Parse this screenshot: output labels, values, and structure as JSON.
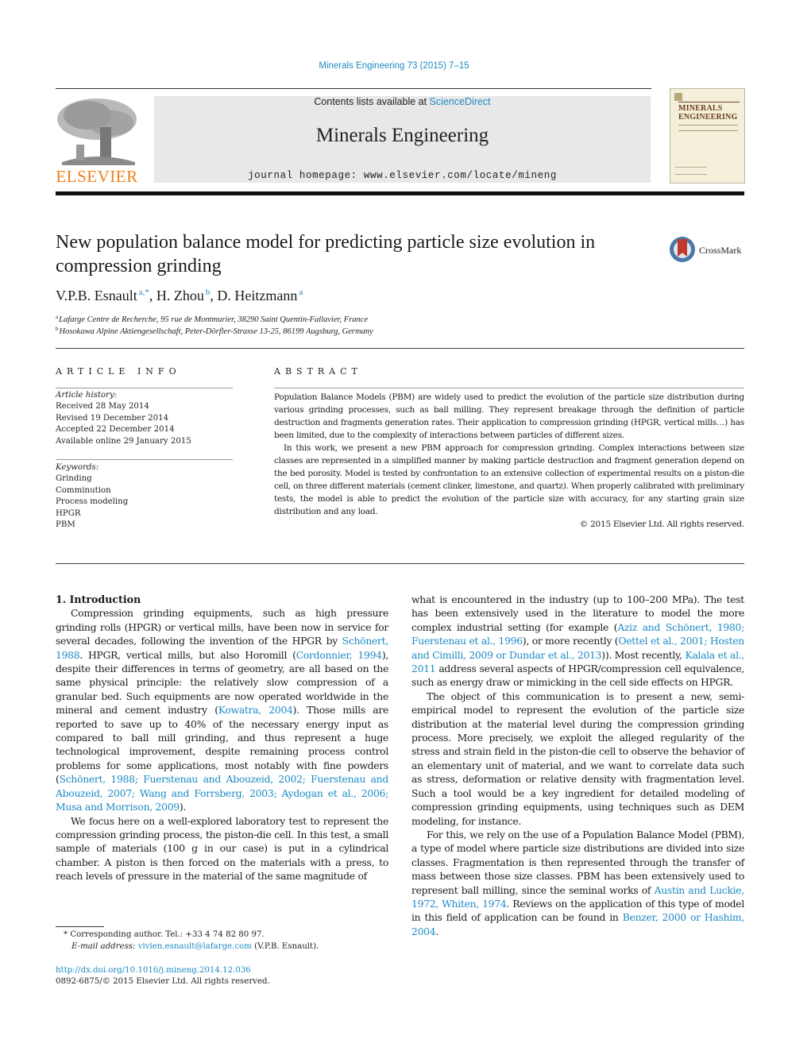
{
  "header": {
    "citation": "Minerals Engineering 73 (2015) 7–15",
    "publisher_logo_text": "ELSEVIER",
    "contents_prefix": "Contents lists available at ",
    "contents_link": "ScienceDirect",
    "journal_name": "Minerals Engineering",
    "homepage": "journal homepage: www.elsevier.com/locate/mineng",
    "cover_title_line1": "MINERALS",
    "cover_title_line2": "ENGINEERING",
    "crossmark_label": "CrossMark"
  },
  "colors": {
    "link": "#1d8ac4",
    "elsevier_orange": "#f07f1a",
    "banner_bg": "#e8e8e8"
  },
  "article": {
    "title": "New population balance model for predicting particle size evolution in compression grinding",
    "authors": [
      {
        "name": "V.P.B. Esnault",
        "sup": "a,*"
      },
      {
        "name": "H. Zhou",
        "sup": "b"
      },
      {
        "name": "D. Heitzmann",
        "sup": "a"
      }
    ],
    "affiliations": [
      {
        "key": "a",
        "text": "Lafarge Centre de Recherche, 95 rue de Montmurier, 38290 Saint Quentin-Fallavier, France"
      },
      {
        "key": "b",
        "text": "Hosokawa Alpine Aktiengesellschaft, Peter-Dörfler-Strasse 13-25, 86199 Augsburg, Germany"
      }
    ]
  },
  "article_info": {
    "heading": "ARTICLE INFO",
    "history_label": "Article history:",
    "history": [
      "Received 28 May 2014",
      "Revised 19 December 2014",
      "Accepted 22 December 2014",
      "Available online 29 January 2015"
    ],
    "keywords_label": "Keywords:",
    "keywords": [
      "Grinding",
      "Comminution",
      "Process modeling",
      "HPGR",
      "PBM"
    ]
  },
  "abstract": {
    "heading": "ABSTRACT",
    "paragraphs": [
      "Population Balance Models (PBM) are widely used to predict the evolution of the particle size distribution during various grinding processes, such as ball milling. They represent breakage through the definition of particle destruction and fragments generation rates. Their application to compression grinding (HPGR, vertical mills…) has been limited, due to the complexity of interactions between particles of different sizes.",
      "In this work, we present a new PBM approach for compression grinding. Complex interactions between size classes are represented in a simplified manner by making particle destruction and fragment generation depend on the bed porosity. Model is tested by confrontation to an extensive collection of experimental results on a piston-die cell, on three different materials (cement clinker, limestone, and quartz). When properly calibrated with preliminary tests, the model is able to predict the evolution of the particle size with accuracy, for any starting grain size distribution and any load."
    ],
    "copyright": "© 2015 Elsevier Ltd. All rights reserved."
  },
  "body": {
    "section_title": "1. Introduction",
    "p1": {
      "t1": "Compression grinding equipments, such as high pressure grinding rolls (HPGR) or vertical mills, have been now in service for several decades, following the invention of the HPGR by ",
      "l1": "Schönert, 1988",
      "t2": ". HPGR, vertical mills, but also Horomill (",
      "l2": "Cordonnier, 1994",
      "t3": "), despite their differences in terms of geometry, are all based on the same physical principle: the relatively slow compression of a granular bed. Such equipments are now operated worldwide in the mineral and cement industry (",
      "l3": "Kowatra, 2004",
      "t4": "). Those mills are reported to save up to 40% of the necessary energy input as compared to ball mill grinding, and thus represent a huge technological improvement, despite remaining process control problems for some applications, most notably with fine powders (",
      "l4": "Schönert, 1988; Fuerstenau and Abouzeid, 2002; Fuerstenau and Abouzeid, 2007; Wang and Forrsberg, 2003; Aydogan et al., 2006; Musa and Morrison, 2009",
      "t5": ")."
    },
    "p2": {
      "t1": "We focus here on a well-explored laboratory test to represent the compression grinding process, the piston-die cell. In this test, a small sample of materials (100 g in our case) is put in a cylindrical chamber. A piston is then forced on the materials with a press, to reach levels of pressure in the material of the same magnitude of what is encountered in the industry (up to 100–200 MPa). The test has been extensively used in the literature to model the more complex industrial setting (for example (",
      "l1": "Aziz and Schönert, 1980; Fuerstenau et al., 1996",
      "t2": "), or more recently (",
      "l2": "Oettel et al., 2001; Hosten and Cimilli, 2009 or Dundar et al., 2013",
      "t3": ")). Most recently, ",
      "l3": "Kalala et al., 2011",
      "t4": " address several aspects of HPGR/compression cell equivalence, such as energy draw or mimicking in the cell side effects on HPGR."
    },
    "p2_left_part": "We focus here on a well-explored laboratory test to represent the compression grinding process, the piston-die cell. In this test, a small sample of materials (100 g in our case) is put in a cylindrical chamber. A piston is then forced on the materials with a press, to reach levels of pressure in the material of the same magnitude of",
    "p2_right_part": {
      "t1": "what is encountered in the industry (up to 100–200 MPa). The test has been extensively used in the literature to model the more complex industrial setting (for example (",
      "l1": "Aziz and Schönert, 1980; Fuerstenau et al., 1996",
      "t2": "), or more recently (",
      "l2": "Oettel et al., 2001; Hosten and Cimilli, 2009 or Dundar et al., 2013",
      "t3": ")). Most recently, ",
      "l3": "Kalala et al., 2011",
      "t4": " address several aspects of HPGR/compression cell equivalence, such as energy draw or mimicking in the cell side effects on HPGR."
    },
    "p3": "The object of this communication is to present a new, semi-empirical model to represent the evolution of the particle size distribution at the material level during the compression grinding process. More precisely, we exploit the alleged regularity of the stress and strain field in the piston-die cell to observe the behavior of an elementary unit of material, and we want to correlate data such as stress, deformation or relative density with fragmentation level. Such a tool would be a key ingredient for detailed modeling of compression grinding equipments, using techniques such as DEM modeling, for instance.",
    "p4": {
      "t1": "For this, we rely on the use of a Population Balance Model (PBM), a type of model where particle size distributions are divided into size classes. Fragmentation is then represented through the transfer of mass between those size classes. PBM has been extensively used to represent ball milling, since the seminal works of ",
      "l1": "Austin and Luckie, 1972, Whiten, 1974",
      "t2": ". Reviews on the application of this type of model in this field of application can be found in ",
      "l2": "Benzer, 2000 or Hashim, 2004",
      "t3": "."
    }
  },
  "footer": {
    "corresponding": "* Corresponding author. Tel.: +33 4 74 82 80 97.",
    "email_label": "E-mail address: ",
    "email": "vivien.esnault@lafarge.com",
    "email_suffix": " (V.P.B. Esnault).",
    "doi": "http://dx.doi.org/10.1016/j.mineng.2014.12.036",
    "issn": "0892-6875/© 2015 Elsevier Ltd. All rights reserved."
  }
}
